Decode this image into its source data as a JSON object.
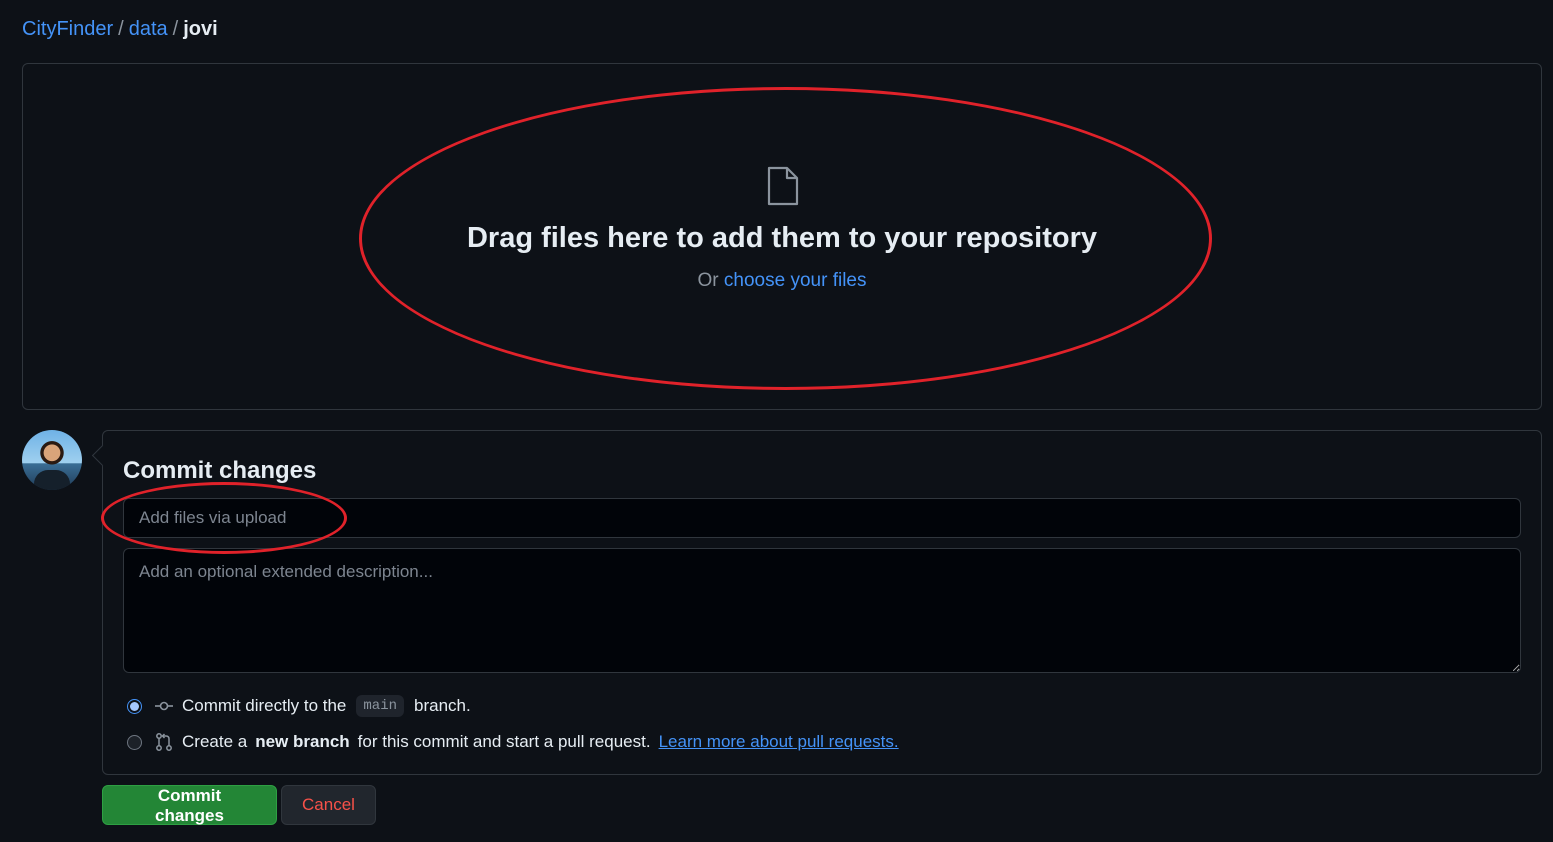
{
  "breadcrumb": {
    "repo": "CityFinder",
    "folder": "data",
    "current": "jovi",
    "separator": "/"
  },
  "dropzone": {
    "icon": "file-icon",
    "title": "Drag files here to add them to your repository",
    "prefix": "Or",
    "choose_link": "choose your files"
  },
  "commit": {
    "title": "Commit changes",
    "summary_placeholder": "Add files via upload",
    "summary_value": "",
    "description_placeholder": "Add an optional extended description...",
    "option_direct": {
      "selected": true,
      "icon": "git-commit-icon",
      "text_before": "Commit directly to the",
      "branch": "main",
      "text_after": "branch."
    },
    "option_new_branch": {
      "selected": false,
      "icon": "git-pull-request-icon",
      "text_before": "Create a",
      "bold": "new branch",
      "text_after": "for this commit and start a pull request.",
      "link": "Learn more about pull requests."
    }
  },
  "buttons": {
    "commit": "Commit changes",
    "cancel": "Cancel"
  },
  "colors": {
    "background": "#0d1117",
    "link": "#4493f8",
    "commit_button": "#238636",
    "cancel_text": "#f85149",
    "annotation": "#e0222a"
  }
}
